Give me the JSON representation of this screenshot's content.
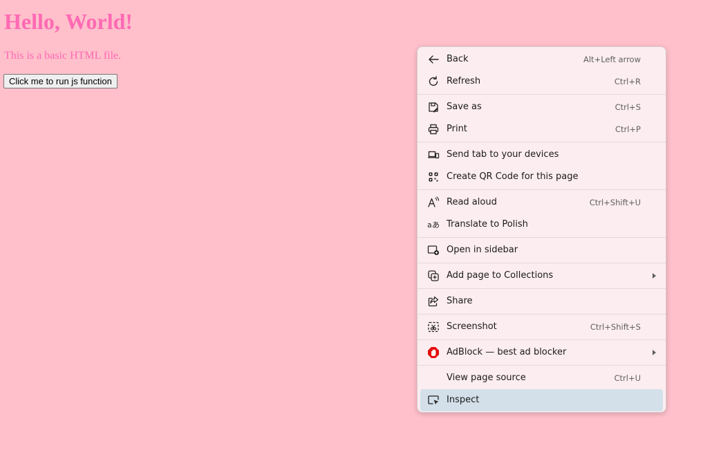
{
  "page": {
    "heading": "Hello, World!",
    "paragraph": "This is a basic HTML file.",
    "button_label": "Click me to run js function",
    "text_color": "#ff69b4",
    "background_color": "#ffc0cb"
  },
  "context_menu": {
    "hover_color": "#d3e0ea",
    "background_color": "#fcedf0",
    "items": [
      {
        "label": "Back",
        "shortcut": "Alt+Left arrow",
        "icon": "back-arrow-icon"
      },
      {
        "label": "Refresh",
        "shortcut": "Ctrl+R",
        "icon": "refresh-icon"
      },
      {
        "label": "Save as",
        "shortcut": "Ctrl+S",
        "icon": "save-icon"
      },
      {
        "label": "Print",
        "shortcut": "Ctrl+P",
        "icon": "printer-icon"
      },
      {
        "label": "Send tab to your devices",
        "shortcut": "",
        "icon": "devices-icon"
      },
      {
        "label": "Create QR Code for this page",
        "shortcut": "",
        "icon": "qr-code-icon"
      },
      {
        "label": "Read aloud",
        "shortcut": "Ctrl+Shift+U",
        "icon": "read-aloud-icon"
      },
      {
        "label": "Translate to Polish",
        "shortcut": "",
        "icon": "translate-icon"
      },
      {
        "label": "Open in sidebar",
        "shortcut": "",
        "icon": "sidebar-icon"
      },
      {
        "label": "Add page to Collections",
        "shortcut": "",
        "icon": "collections-icon",
        "submenu": true
      },
      {
        "label": "Share",
        "shortcut": "",
        "icon": "share-icon"
      },
      {
        "label": "Screenshot",
        "shortcut": "Ctrl+Shift+S",
        "icon": "screenshot-icon"
      },
      {
        "label": "AdBlock — best ad blocker",
        "shortcut": "",
        "icon": "adblock-icon",
        "submenu": true
      },
      {
        "label": "View page source",
        "shortcut": "Ctrl+U",
        "icon": ""
      },
      {
        "label": "Inspect",
        "shortcut": "",
        "icon": "inspect-icon",
        "highlighted": true
      }
    ]
  }
}
